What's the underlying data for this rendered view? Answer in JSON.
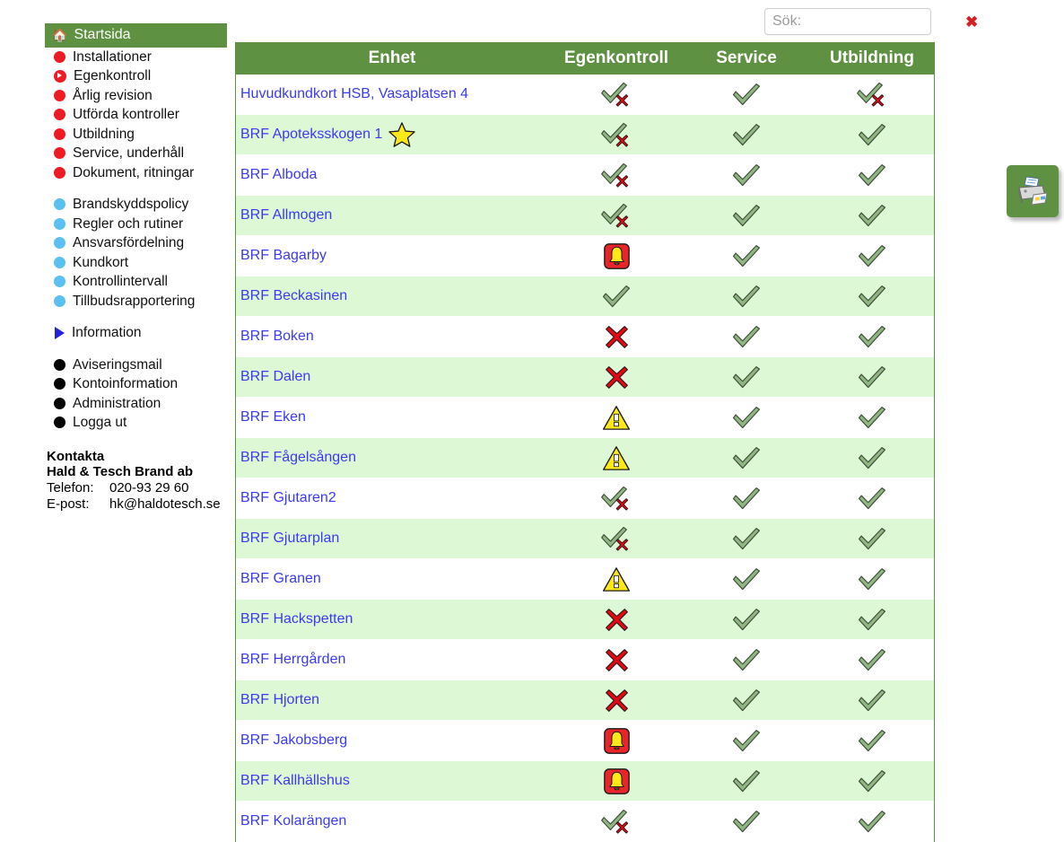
{
  "sidebar": {
    "home": {
      "label": "Startsida",
      "icon": "home-icon"
    },
    "group_red": [
      {
        "label": "Installationer",
        "icon": "red-dot-icon"
      },
      {
        "label": "Egenkontroll",
        "icon": "red-arrow-circle-icon"
      },
      {
        "label": "Årlig revision",
        "icon": "red-dot-icon"
      },
      {
        "label": "Utförda kontroller",
        "icon": "red-dot-icon"
      },
      {
        "label": "Utbildning",
        "icon": "red-dot-icon"
      },
      {
        "label": "Service, underhåll",
        "icon": "red-dot-icon"
      },
      {
        "label": "Dokument, ritningar",
        "icon": "red-dot-icon"
      }
    ],
    "group_blue": [
      {
        "label": "Brandskyddspolicy",
        "icon": "blue-dot-icon"
      },
      {
        "label": "Regler och rutiner",
        "icon": "blue-dot-icon"
      },
      {
        "label": "Ansvarsfördelning",
        "icon": "blue-dot-icon"
      },
      {
        "label": "Kundkort",
        "icon": "blue-dot-icon"
      },
      {
        "label": "Kontrollintervall",
        "icon": "blue-dot-icon"
      },
      {
        "label": "Tillbudsrapportering",
        "icon": "blue-dot-icon"
      }
    ],
    "information": {
      "label": "Information",
      "icon": "blue-triangle-icon"
    },
    "group_black": [
      {
        "label": "Aviseringsmail",
        "icon": "black-dot-icon"
      },
      {
        "label": "Kontoinformation",
        "icon": "black-dot-icon"
      },
      {
        "label": "Administration",
        "icon": "black-dot-icon"
      },
      {
        "label": "Logga ut",
        "icon": "black-dot-icon"
      }
    ],
    "contact": {
      "heading": "Kontakta",
      "company": "Hald & Tesch Brand ab",
      "phone_label": "Telefon:",
      "phone_value": "020-93 29 60",
      "email_label": "E-post:",
      "email_value": "hk@haldotesch.se"
    }
  },
  "search": {
    "placeholder": "Sök:",
    "value": "",
    "clear_label": "✖",
    "clear_icon": "red-x-clear-icon"
  },
  "print_button": {
    "icon": "printer-icon",
    "title": "Skriv ut"
  },
  "table": {
    "columns": [
      "Enhet",
      "Egenkontroll",
      "Service",
      "Utbildning"
    ],
    "rows": [
      {
        "name": "Huvudkundkort HSB, Vasaplatsen 4",
        "star": false,
        "egenkontroll": "check-x",
        "service": "check",
        "utbildning": "check-x"
      },
      {
        "name": "BRF Apoteksskogen 1",
        "star": true,
        "egenkontroll": "check-x",
        "service": "check",
        "utbildning": "check"
      },
      {
        "name": "BRF Alboda",
        "star": false,
        "egenkontroll": "check-x",
        "service": "check",
        "utbildning": "check"
      },
      {
        "name": "BRF Allmogen",
        "star": false,
        "egenkontroll": "check-x",
        "service": "check",
        "utbildning": "check"
      },
      {
        "name": "BRF Bagarby",
        "star": false,
        "egenkontroll": "bell",
        "service": "check",
        "utbildning": "check"
      },
      {
        "name": "BRF Beckasinen",
        "star": false,
        "egenkontroll": "check",
        "service": "check",
        "utbildning": "check"
      },
      {
        "name": "BRF Boken",
        "star": false,
        "egenkontroll": "x",
        "service": "check",
        "utbildning": "check"
      },
      {
        "name": "BRF Dalen",
        "star": false,
        "egenkontroll": "x",
        "service": "check",
        "utbildning": "check"
      },
      {
        "name": "BRF Eken",
        "star": false,
        "egenkontroll": "warning",
        "service": "check",
        "utbildning": "check"
      },
      {
        "name": "BRF Fågelsången",
        "star": false,
        "egenkontroll": "warning",
        "service": "check",
        "utbildning": "check"
      },
      {
        "name": "BRF Gjutaren2",
        "star": false,
        "egenkontroll": "check-x",
        "service": "check",
        "utbildning": "check"
      },
      {
        "name": "BRF Gjutarplan",
        "star": false,
        "egenkontroll": "check-x",
        "service": "check",
        "utbildning": "check"
      },
      {
        "name": "BRF Granen",
        "star": false,
        "egenkontroll": "warning",
        "service": "check",
        "utbildning": "check"
      },
      {
        "name": "BRF Hackspetten",
        "star": false,
        "egenkontroll": "x",
        "service": "check",
        "utbildning": "check"
      },
      {
        "name": "BRF Herrgården",
        "star": false,
        "egenkontroll": "x",
        "service": "check",
        "utbildning": "check"
      },
      {
        "name": "BRF Hjorten",
        "star": false,
        "egenkontroll": "x",
        "service": "check",
        "utbildning": "check"
      },
      {
        "name": "BRF Jakobsberg",
        "star": false,
        "egenkontroll": "bell",
        "service": "check",
        "utbildning": "check"
      },
      {
        "name": "BRF Kallhällshus",
        "star": false,
        "egenkontroll": "bell",
        "service": "check",
        "utbildning": "check"
      },
      {
        "name": "BRF Kolarängen",
        "star": false,
        "egenkontroll": "check-x",
        "service": "check",
        "utbildning": "check"
      }
    ]
  },
  "colors": {
    "header_green": "#5e9141",
    "row_green": "#ddf8d5",
    "link_blue": "#3a3af0",
    "red": "#ed1c24",
    "blue_dot": "#5bc0ef",
    "check_green": "#8fb682",
    "warning_yellow": "#ffe81a",
    "star_yellow": "#ffe81a"
  }
}
